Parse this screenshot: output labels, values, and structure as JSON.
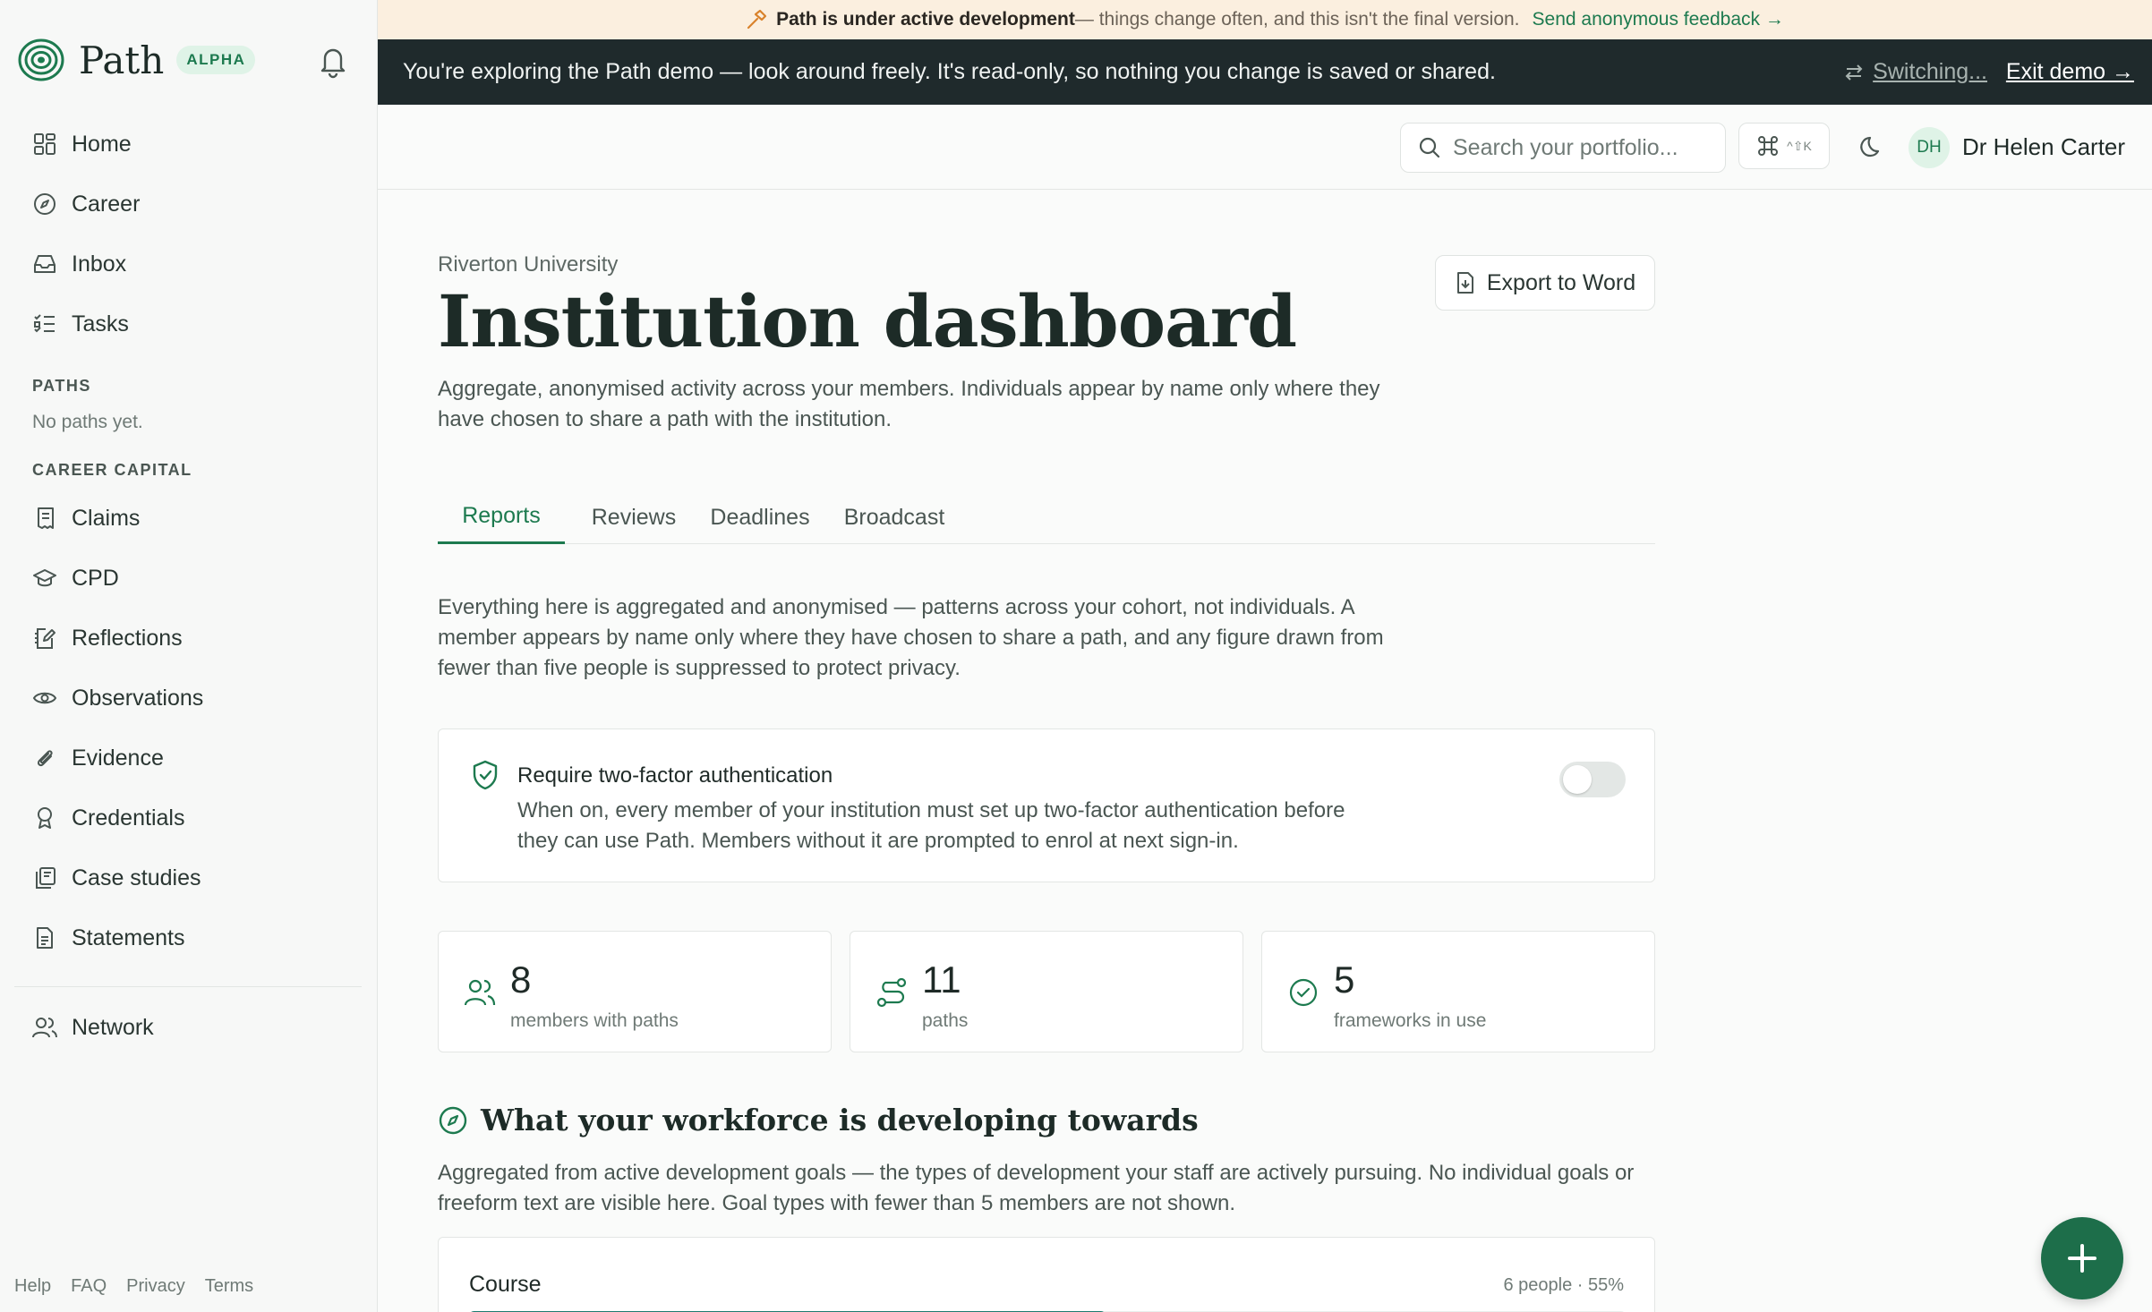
{
  "brand": {
    "name": "Path",
    "badge": "ALPHA"
  },
  "sidebar": {
    "items_top": [
      {
        "label": "Home",
        "icon": "grid-icon"
      },
      {
        "label": "Career",
        "icon": "compass-icon"
      },
      {
        "label": "Inbox",
        "icon": "inbox-icon"
      },
      {
        "label": "Tasks",
        "icon": "list-check-icon"
      }
    ],
    "paths_heading": "PATHS",
    "paths_empty": "No paths yet.",
    "capital_heading": "CAREER CAPITAL",
    "items_capital": [
      {
        "label": "Claims",
        "icon": "receipt-icon"
      },
      {
        "label": "CPD",
        "icon": "graduation-cap-icon"
      },
      {
        "label": "Reflections",
        "icon": "notebook-pen-icon"
      },
      {
        "label": "Observations",
        "icon": "eye-icon"
      },
      {
        "label": "Evidence",
        "icon": "paperclip-icon"
      },
      {
        "label": "Credentials",
        "icon": "award-icon"
      },
      {
        "label": "Case studies",
        "icon": "library-icon"
      },
      {
        "label": "Statements",
        "icon": "document-icon"
      }
    ],
    "network": {
      "label": "Network",
      "icon": "users-icon"
    },
    "footer": [
      "Help",
      "FAQ",
      "Privacy",
      "Terms"
    ]
  },
  "dev_banner": {
    "strong": "Path is under active development",
    "rest": " — things change often, and this isn't the final version.",
    "link": "Send anonymous feedback →"
  },
  "demo_bar": {
    "message": "You're exploring the Path demo — look around freely. It's read-only, so nothing you change is saved or shared.",
    "switching": "Switching...",
    "exit": "Exit demo →"
  },
  "header": {
    "search_placeholder": "Search your portfolio...",
    "shortcut": "^⇧K",
    "user_initials": "DH",
    "user_name": "Dr Helen Carter"
  },
  "page": {
    "org": "Riverton University",
    "title": "Institution dashboard",
    "export_label": "Export to Word",
    "intro": "Aggregate, anonymised activity across your members. Individuals appear by name only where they have chosen to share a path with the institution.",
    "tabs": [
      "Reports",
      "Reviews",
      "Deadlines",
      "Broadcast"
    ],
    "active_tab": "Reports",
    "description": "Everything here is aggregated and anonymised — patterns across your cohort, not individuals. A member appears by name only where they have chosen to share a path, and any figure drawn from fewer than five people is suppressed to protect privacy."
  },
  "two_factor": {
    "title": "Require two-factor authentication",
    "body": "When on, every member of your institution must set up two-factor authentication before they can use Path. Members without it are prompted to enrol at next sign-in.",
    "enabled": false
  },
  "stats": [
    {
      "value": "8",
      "caption": "members with paths",
      "icon": "users-icon"
    },
    {
      "value": "11",
      "caption": "paths",
      "icon": "route-icon"
    },
    {
      "value": "5",
      "caption": "frameworks in use",
      "icon": "check-circle-icon"
    }
  ],
  "workforce": {
    "heading": "What your workforce is developing towards",
    "description": "Aggregated from active development goals — the types of development your staff are actively pursuing. No individual goals or freeform text are visible here. Goal types with fewer than 5 members are not shown.",
    "goals": [
      {
        "name": "Course",
        "meta": "6 people · 55%",
        "fraction": 0.55
      }
    ]
  },
  "colors": {
    "accent": "#1d7a4f",
    "banner": "#fbefdf",
    "demo_bar": "#1f2a2c"
  }
}
